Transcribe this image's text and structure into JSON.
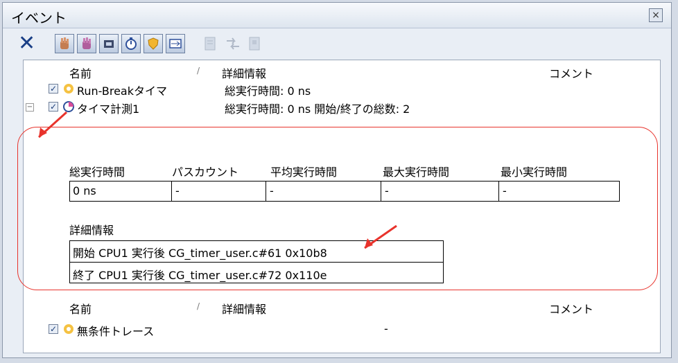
{
  "window": {
    "title": "イベント",
    "close_symbol": "×"
  },
  "toolbar": {
    "delete_symbol": "✕",
    "icons": [
      "hand-icon",
      "hand-icon",
      "chip-icon",
      "timer-icon",
      "shield-icon",
      "trace-icon"
    ],
    "disabled_icons": [
      "document-icon",
      "arrows-icon",
      "document-icon"
    ]
  },
  "headers": {
    "name": "名前",
    "sort": "/",
    "detail": "詳細情報",
    "comment": "コメント"
  },
  "events": [
    {
      "name": "Run-Breakタイマ",
      "detail": "総実行時間: 0 ns"
    },
    {
      "name": "タイマ計測1",
      "detail": "総実行時間: 0 ns  開始/終了の総数: 2"
    }
  ],
  "measure_table": {
    "headers": [
      "総実行時間",
      "パスカウント",
      "平均実行時間",
      "最大実行時間",
      "最小実行時間"
    ],
    "values": [
      "0 ns",
      "-",
      "-",
      "-",
      "-"
    ]
  },
  "detail_table": {
    "header": "詳細情報",
    "rows": [
      "開始 CPU1 実行後 CG_timer_user.c#61 0x10b8",
      "終了 CPU1 実行後 CG_timer_user.c#72 0x110e"
    ]
  },
  "headers2": {
    "name": "名前",
    "sort": "/",
    "detail": "詳細情報",
    "comment": "コメント"
  },
  "event3": {
    "name": "無条件トレース",
    "detail": "-"
  },
  "colors": {
    "highlight": "#e8332c",
    "toolbar_icon": "#1a3f86"
  }
}
